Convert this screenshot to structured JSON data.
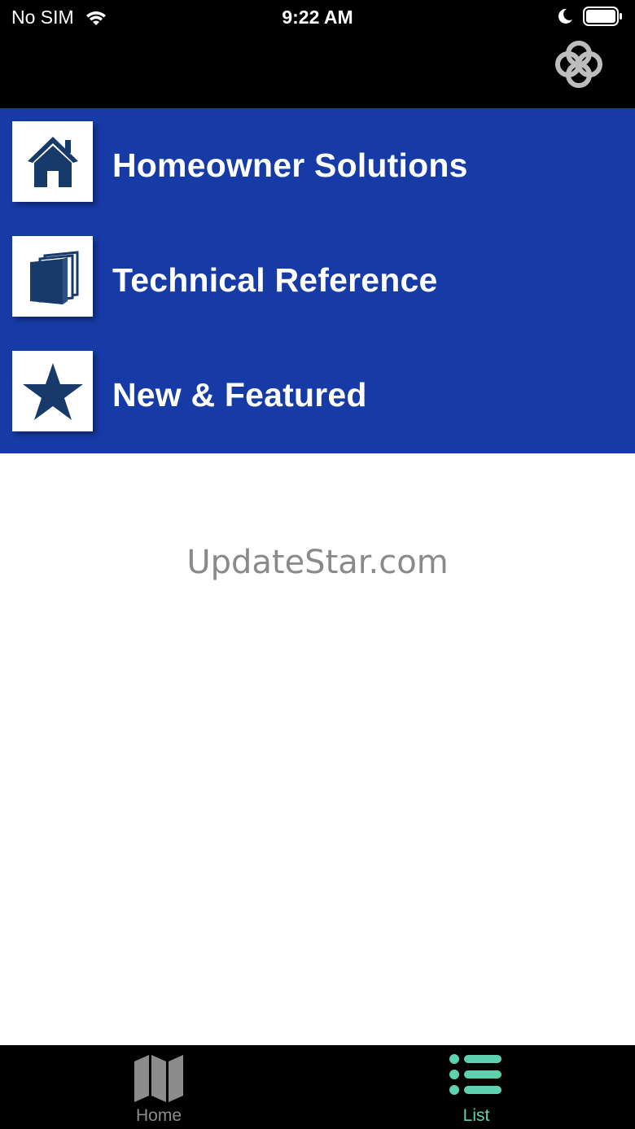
{
  "status_bar": {
    "carrier": "No SIM",
    "time": "9:22 AM"
  },
  "menu": {
    "items": [
      {
        "label": "Homeowner Solutions",
        "icon": "house-icon"
      },
      {
        "label": "Technical Reference",
        "icon": "books-icon"
      },
      {
        "label": "New & Featured",
        "icon": "star-icon"
      }
    ]
  },
  "watermark": "UpdateStar.com",
  "tab_bar": {
    "tabs": [
      {
        "label": "Home",
        "icon": "map-icon",
        "selected": false
      },
      {
        "label": "List",
        "icon": "list-icon",
        "selected": true
      }
    ]
  },
  "colors": {
    "menu_background": "#163ba6",
    "icon_navy": "#173a6b",
    "tab_selected": "#5fd1b0",
    "tab_unselected": "#8c8c8c"
  }
}
